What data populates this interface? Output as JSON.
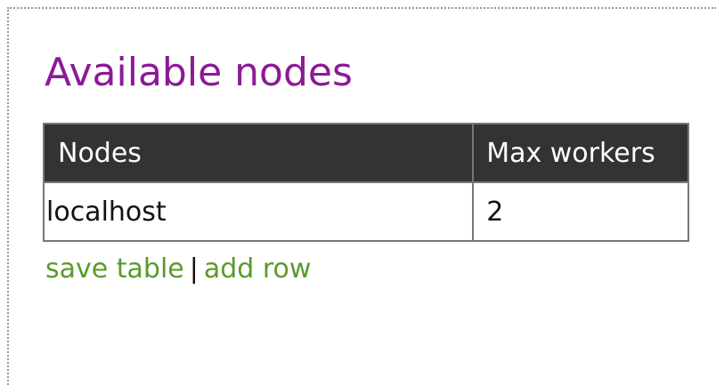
{
  "heading": "Available nodes",
  "table": {
    "headers": [
      "Nodes",
      "Max workers"
    ],
    "rows": [
      [
        "localhost",
        "2"
      ]
    ]
  },
  "actions": {
    "save_label": "save table",
    "separator": "|",
    "add_label": "add row"
  },
  "colors": {
    "heading": "#8b1a96",
    "link": "#5a9a2a",
    "header_bg": "#333333"
  }
}
